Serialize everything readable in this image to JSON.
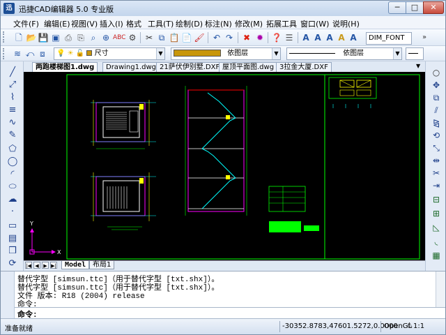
{
  "window": {
    "title": "迅捷CAD编辑器 5.0 专业版",
    "icon_text": "迅",
    "min_label": "─",
    "max_label": "□",
    "close_label": "✕"
  },
  "menu": [
    {
      "label": "文件(F)"
    },
    {
      "label": "编辑(E)"
    },
    {
      "label": "视图(V)"
    },
    {
      "label": "插入(I)"
    },
    {
      "label": "格式"
    },
    {
      "label": "工具(T)"
    },
    {
      "label": "绘制(D)"
    },
    {
      "label": "标注(N)"
    },
    {
      "label": "修改(M)"
    },
    {
      "label": "拓展工具"
    },
    {
      "label": "窗口(W)"
    },
    {
      "label": "说明(H)"
    }
  ],
  "toolbar": {
    "text_style_combo": "DIM_FONT",
    "layer_name": "尺寸",
    "color_combo": "依图层",
    "linetype_combo": "依图层"
  },
  "tabs": [
    {
      "label": "两跑楼梯图1.dwg",
      "active": true
    },
    {
      "label": "Drawing1.dwg",
      "active": false
    },
    {
      "label": "21萨伏伊别墅.DXF",
      "active": false
    },
    {
      "label": "屋顶平面图.dwg",
      "active": false
    },
    {
      "label": "3拉金大厦.DXF",
      "active": false
    }
  ],
  "layout_tabs": [
    {
      "label": "Model",
      "active": true
    },
    {
      "label": "布局1",
      "active": false
    }
  ],
  "command_history": [
    "替代字型 [simsun.ttc]（用于替代字型 [txt.shx]）。",
    "替代字型 [simsun.ttc]（用于替代字型 [txt.shx]）。",
    "文件 版本: R18 (2004) release",
    "命令:"
  ],
  "command_prompt": "命令:",
  "status": {
    "ready": "准备就绪",
    "coords": "-30352.8783,47601.5272,0.0000",
    "renderer": "OpenGL",
    "scale": "1:1"
  },
  "colors": {
    "canvas_bg": "#000000",
    "drawing_green": "#00ff00",
    "drawing_magenta": "#ff00ff",
    "drawing_cyan": "#00ffff",
    "drawing_yellow": "#ffff00",
    "layer_color": "#c8960a"
  }
}
